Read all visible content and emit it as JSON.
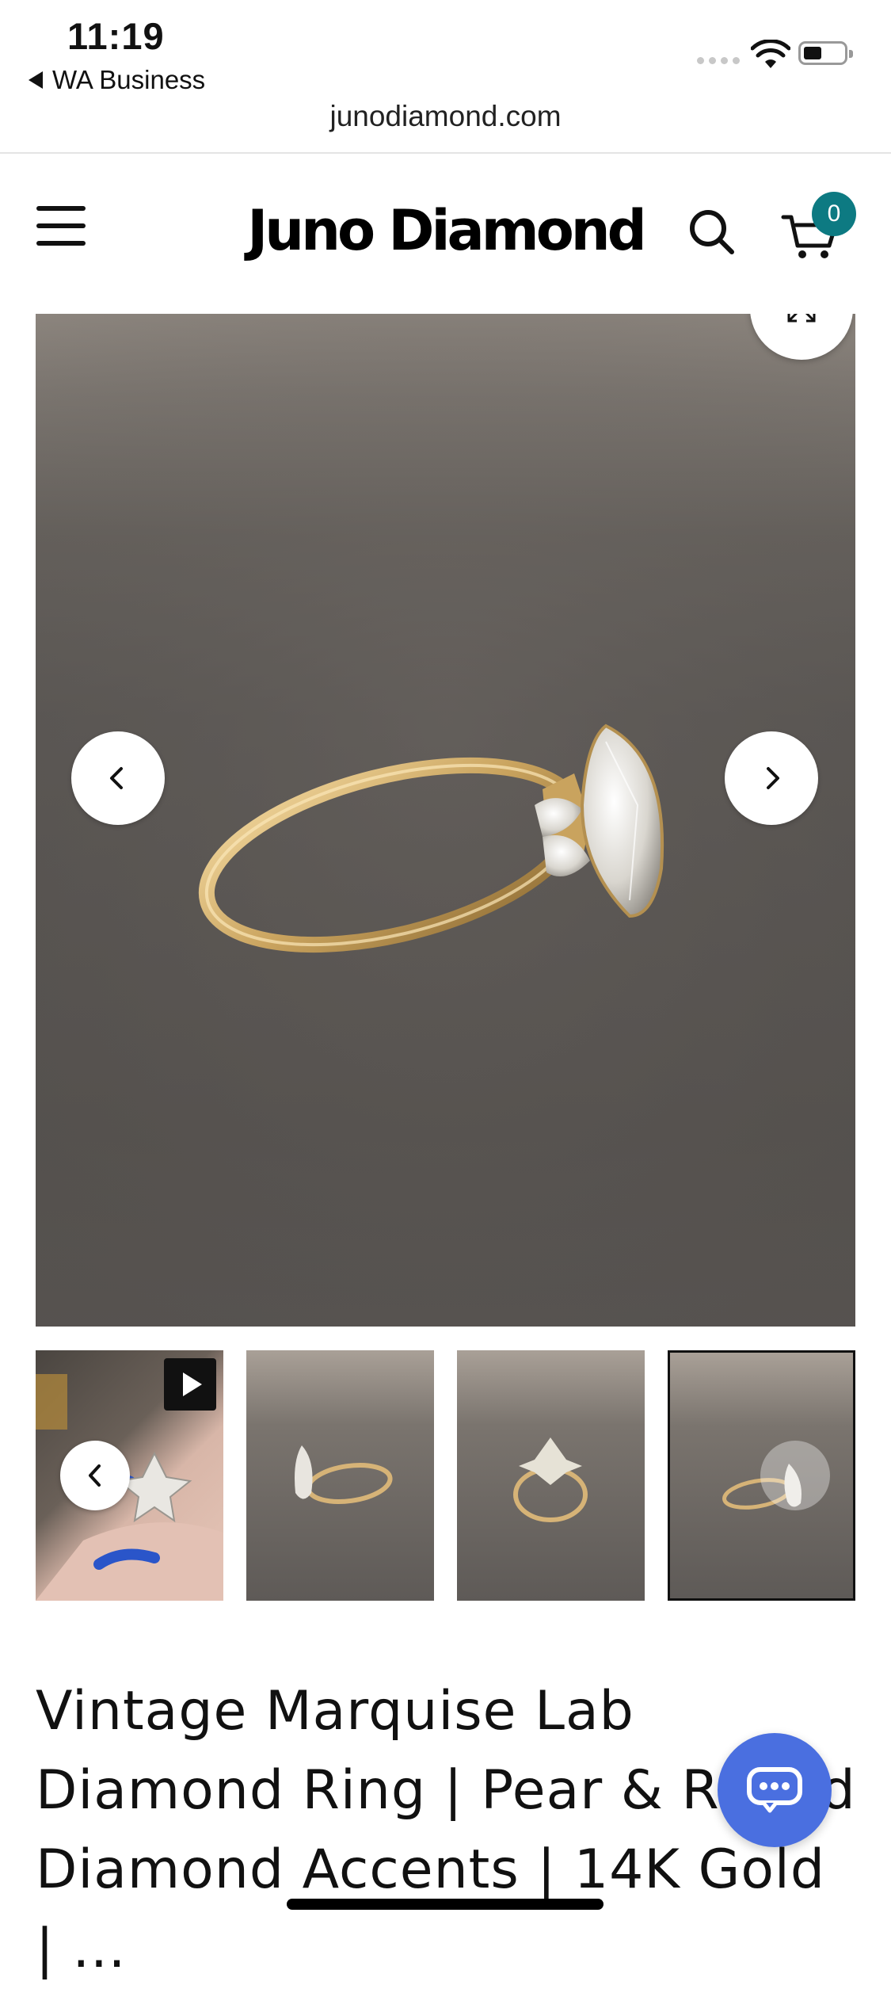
{
  "status_bar": {
    "time": "11:19",
    "back_app_label": "WA Business"
  },
  "browser": {
    "url": "junodiamond.com"
  },
  "header": {
    "menu_icon": "hamburger-menu-icon",
    "logo_text": "Juno Diamond",
    "search_icon": "search-icon",
    "cart_icon": "shopping-cart-icon",
    "cart_count": "0",
    "accent_color": "#0d7a82"
  },
  "gallery": {
    "main_image_alt": "gold marquise lab diamond ring side view",
    "expand_icon": "expand-icon",
    "prev_icon": "chevron-left-icon",
    "next_icon": "chevron-right-icon",
    "thumbnails": [
      {
        "kind": "video",
        "icon": "play-icon"
      },
      {
        "kind": "image"
      },
      {
        "kind": "image"
      },
      {
        "kind": "image",
        "selected": true
      }
    ]
  },
  "product": {
    "title": "Vintage Marquise Lab Diamond Ring | Pear & Round Diamond Accents | 14K Gold | ..."
  },
  "chat": {
    "icon": "chat-bubble-icon",
    "color": "#4a6fe0"
  }
}
